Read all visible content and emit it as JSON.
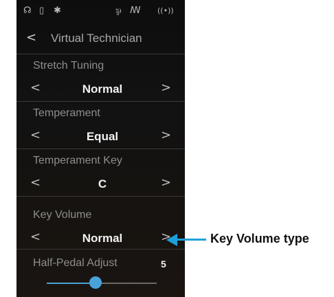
{
  "status_bar": {
    "icons": [
      "headphones-icon",
      "usb-icon",
      "bluetooth-icon",
      "microphone-icon",
      "audio-recorder-icon",
      "wireless-icon"
    ],
    "glyphs": [
      "☊",
      "▯",
      "✱",
      "⅌",
      "ꟿ",
      "((•))"
    ]
  },
  "header": {
    "back_label": "<",
    "title": "Virtual Technician"
  },
  "settings": [
    {
      "label": "Stretch Tuning",
      "value": "Normal"
    },
    {
      "label": "Temperament",
      "value": "Equal"
    },
    {
      "label": "Temperament Key",
      "value": "C"
    },
    {
      "label": "Key Volume",
      "value": "Normal"
    }
  ],
  "slider": {
    "label": "Half-Pedal Adjust",
    "value": "5",
    "min": 1,
    "max": 10,
    "accent": "#4aa3d8"
  },
  "arrows": {
    "left": "<",
    "right": ">"
  },
  "callout": {
    "text": "Key Volume type",
    "color": "#1ea0db"
  }
}
